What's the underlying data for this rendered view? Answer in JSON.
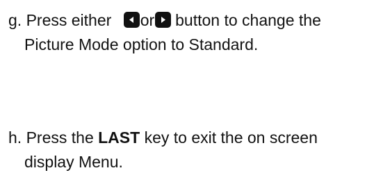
{
  "step_g": {
    "marker": "g.",
    "prefix": "Press either",
    "or_word": "or",
    "suffix": "button to change the",
    "line2": "Picture Mode option to Standard.",
    "left_button_icon": "left-arrow-button-icon",
    "right_button_icon": "right-arrow-button-icon"
  },
  "step_h": {
    "marker": "h.",
    "prefix": "Press the",
    "key_name": "LAST",
    "suffix": "key to exit the on screen",
    "line2": "display Menu."
  },
  "colors": {
    "text": "#111111",
    "icon_fill": "#111111",
    "icon_glyph": "#ffffff"
  }
}
